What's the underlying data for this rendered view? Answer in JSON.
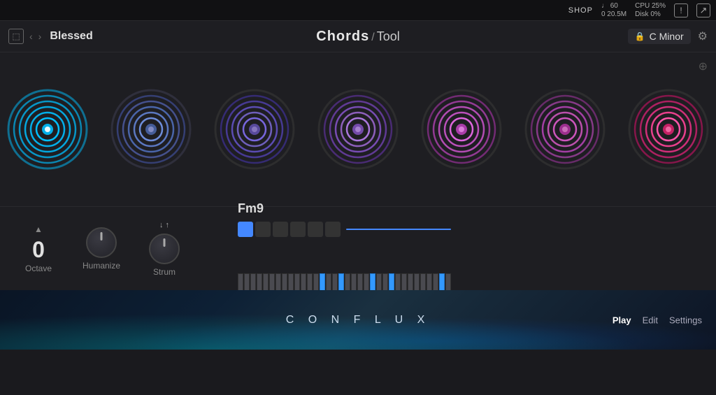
{
  "topbar": {
    "shop_label": "SHOP",
    "midi_notes": "♩ 60",
    "midi_mem": "0  20.5M",
    "cpu_label": "CPU 25%",
    "disk_label": "Disk 0%",
    "warning_symbol": "!",
    "cursor_symbol": "↗"
  },
  "navbar": {
    "back_arrow": "‹",
    "forward_arrow": "›",
    "title": "Blessed",
    "chords_label": "Chords",
    "tool_label": "Tool",
    "key_label": "C Minor",
    "lock_symbol": "🔒",
    "gear_symbol": "⚙"
  },
  "chords": {
    "position_icon": "⊕",
    "knobs": [
      {
        "id": 1,
        "color1": "#00bfff",
        "color2": "#0080c0",
        "active": true
      },
      {
        "id": 2,
        "color1": "#5577ff",
        "color2": "#334499",
        "active": false
      },
      {
        "id": 3,
        "color1": "#6644cc",
        "color2": "#443388",
        "active": false
      },
      {
        "id": 4,
        "color1": "#8833cc",
        "color2": "#662299",
        "active": false
      },
      {
        "id": 5,
        "color1": "#cc44cc",
        "color2": "#993399",
        "active": false
      },
      {
        "id": 6,
        "color1": "#bb33bb",
        "color2": "#882277",
        "active": false
      },
      {
        "id": 7,
        "color1": "#ff3399",
        "color2": "#cc1166",
        "active": false
      }
    ]
  },
  "controls": {
    "octave_value": "0",
    "octave_label": "Octave",
    "humanize_label": "Humanize",
    "strum_label": "Strum",
    "chord_name": "Fm9",
    "strum_arrows": "↓ ↑"
  },
  "bottom": {
    "logo": "C O N F L U X",
    "nav_play": "Play",
    "nav_edit": "Edit",
    "nav_settings": "Settings"
  }
}
